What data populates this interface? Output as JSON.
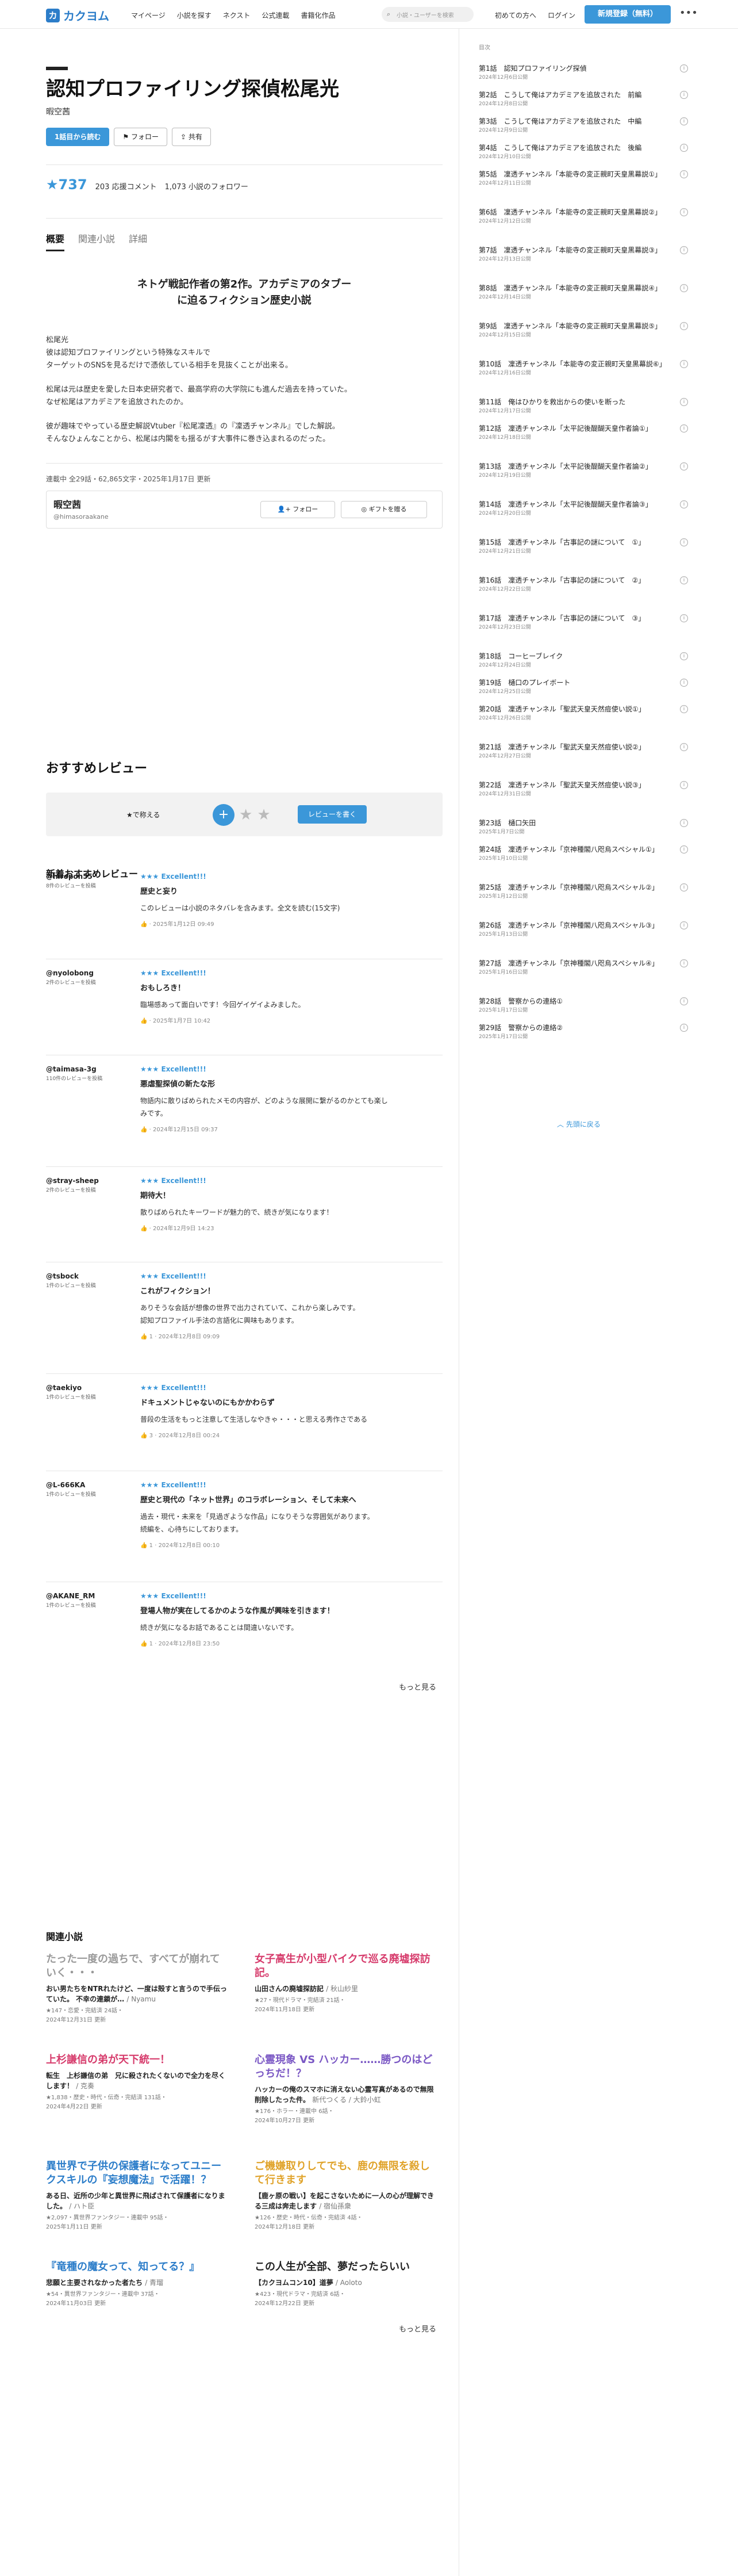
{
  "header": {
    "logo_mark": "カ",
    "logo_text": "カクヨム",
    "nav": [
      "マイページ",
      "小説を探す",
      "ネクスト",
      "公式連載",
      "書籍化作品"
    ],
    "search_placeholder": "小説・ユーザーを検索",
    "beginner": "初めての方へ",
    "login": "ログイン",
    "signup": "新規登録（無料）"
  },
  "work": {
    "title": "認知プロファイリング探偵松尾光",
    "author": "暇空茜",
    "btn_read": "1話目から読む",
    "btn_follow": "フォロー",
    "btn_share": "共有",
    "stars": "★737",
    "review_comments": "203 応援コメント",
    "followers": "1,073 小説のフォロワー"
  },
  "tabs": [
    "概要",
    "関連小説",
    "詳細"
  ],
  "catch": [
    "ネトゲ戦記作者の第2作。アカデミアのタブー",
    "に迫るフィクション歴史小説"
  ],
  "intro": [
    [
      "松尾光",
      "彼は認知プロファイリングという特殊なスキルで",
      "ターゲットのSNSを見るだけで憑依している相手を見抜くことが出来る。"
    ],
    [
      "松尾は元は歴史を愛した日本史研究者で、最高学府の大学院にも進んだ過去を持っていた。",
      "なぜ松尾はアカデミアを追放されたのか。"
    ],
    [
      "彼が趣味でやっている歴史解説Vtuber『松尾凜透』の『凜透チャンネル』でした解説。",
      "そんなひょんなことから、松尾は内閣をも揺るがす大事件に巻き込まれるのだった。"
    ]
  ],
  "meta": "連載中 全29話・62,865文字・2025年1月17日 更新",
  "author_box": {
    "name": "暇空茜",
    "id": "@himasoraakane",
    "follow": "フォロー",
    "gift": "ギフトを贈る"
  },
  "reviews_section": {
    "title": "おすすめレビュー",
    "rate_label": "★で称える",
    "write": "レビューを書く",
    "new_title": "新着おすすめレビュー",
    "items": [
      {
        "user": "@hiropon55",
        "count": "8件のレビューを投稿",
        "score": "★★★ Excellent!!!",
        "title": "歴史と妄り",
        "text": [
          "このレビューは小説のネタバレを含みます。全文を読む(15文字)"
        ],
        "likes": "",
        "date": "2025年1月12日 09:49"
      },
      {
        "user": "@nyolobong",
        "count": "2件のレビューを投稿",
        "score": "★★★ Excellent!!!",
        "title": "おもしろき！",
        "text": [
          "臨場感あって面白いです！今回ゲイゲイよみました。"
        ],
        "likes": "",
        "date": "2025年1月7日 10:42"
      },
      {
        "user": "@taimasa-3g",
        "count": "110件のレビューを投稿",
        "score": "★★★ Excellent!!!",
        "title": "悪虐聖探偵の新たな形",
        "text": [
          "物語内に散りばめられたメモの内容が、どのような展開に繋がるのかとても楽し",
          "みです。"
        ],
        "likes": "",
        "date": "2024年12月15日 09:37"
      },
      {
        "user": "@stray-sheep",
        "count": "2件のレビューを投稿",
        "score": "★★★ Excellent!!!",
        "title": "期待大！",
        "text": [
          "散りばめられたキーワードが魅力的で、続きが気になります！"
        ],
        "likes": "",
        "date": "2024年12月9日 14:23"
      },
      {
        "user": "@tsbock",
        "count": "1件のレビューを投稿",
        "score": "★★★ Excellent!!!",
        "title": "これがフィクション！",
        "text": [
          "ありそうな会話が想像の世界で出力されていて、これから楽しみです。",
          "認知プロファイル手法の言語化に興味もあります。"
        ],
        "likes": "1",
        "date": "2024年12月8日 09:09"
      },
      {
        "user": "@taekiyo",
        "count": "1件のレビューを投稿",
        "score": "★★★ Excellent!!!",
        "title": "ドキュメントじゃないのにもかかわらず",
        "text": [
          "普段の生活をもっと注意して生活しなやきゃ・・・と思える秀作さである"
        ],
        "likes": "3",
        "date": "2024年12月8日 00:24"
      },
      {
        "user": "@L-666KA",
        "count": "1件のレビューを投稿",
        "score": "★★★ Excellent!!!",
        "title": "歴史と現代の「ネット世界」のコラボレーション、そして未来へ",
        "text": [
          "過去・現代・未来を「見過ぎような作品」になりそうな雰囲気があります。",
          "続編を、心待ちにしております。"
        ],
        "likes": "1",
        "date": "2024年12月8日 00:10"
      },
      {
        "user": "@AKANE_RM",
        "count": "1件のレビューを投稿",
        "score": "★★★ Excellent!!!",
        "title": "登場人物が実在してるかのような作風が興味を引きます！",
        "text": [
          "続きが気になるお話であることは間違いないです。"
        ],
        "likes": "1",
        "date": "2024年12月8日 23:50"
      }
    ],
    "see_more": "もっと見る"
  },
  "related": {
    "title": "関連小説",
    "items": [
      {
        "title": "たった一度の過ちで、すべてが崩れていく・・・",
        "sub": "おい男たちをNTRれたけど、一度は殻すと言うので手伝っていた。 不幸の連鎖が…",
        "author": "/ Nyamu",
        "meta": [
          "★147・恋愛・完結済 24話・",
          "2024年12月31日 更新"
        ],
        "color": "#999999"
      },
      {
        "title": "女子高生が小型バイクで巡る廃墟探訪記。",
        "sub": "山田さんの廃墟探訪記",
        "author": "/ 秋山紗里",
        "meta": [
          "★27・現代ドラマ・完結済 21話・",
          "2024年11月18日 更新"
        ],
        "color": "#d63a6b"
      },
      {
        "title": "上杉謙信の弟が天下統一！",
        "sub": "転生　上杉謙信の弟　兄に殺されたくないので全力を尽くします！",
        "author": "/ 克奏",
        "meta": [
          "★1,838・歴史・時代・伝奇・完結済 131話・",
          "2024年4月22日 更新"
        ],
        "color": "#d63a6b"
      },
      {
        "title": "心霊現象 VS ハッカー……勝つのはどっちだ！？",
        "sub": "ハッカーの俺のスマホに消えない心霊写真があるので無限削除したった件。",
        "author": "新代つくる / 大鈴小虹",
        "meta": [
          "★176・ホラー・連載中 6話・",
          "2024年10月27日 更新"
        ],
        "color": "#7a57c4"
      },
      {
        "title": "異世界で子供の保護者になってユニークスキルの『妄想魔法』で活躍！？",
        "sub": "ある日、近所の少年と異世界に飛ばされて保護者になりました。",
        "author": "/ ハト臣",
        "meta": [
          "★2,097・異世界ファンタジー・連載中 95話・",
          "2025年1月11日 更新"
        ],
        "color": "#2c7dc9"
      },
      {
        "title": "ご機嫌取りしてでも、鹿の無限を殺して行きます",
        "sub": "【鹿ヶ原の戦い】を起こさないために一人の心が理解できる三成は奔走します",
        "author": "/ 宿仙孫衆",
        "meta": [
          "★126・歴史・時代・伝奇・完結済 4話・",
          "2024年12月18日 更新"
        ],
        "color": "#e0a32a"
      },
      {
        "title": "『竜種の魔女って、知ってる？』",
        "sub": "悲願と主要されなかった者たち",
        "author": "/ 青瑠",
        "meta": [
          "★54・異世界ファンタジー・連載中 37話・",
          "2024年11月03日 更新"
        ],
        "color": "#2c7dc9"
      },
      {
        "title": "この人生が全部、夢だったらいい",
        "sub": "【カクヨムコン10】道夢",
        "author": "/ Aoloto",
        "meta": [
          "★423・現代ドラマ・完結済 6話・",
          "2024年12月22日 更新"
        ],
        "color": "#222222"
      }
    ],
    "see_more": "もっと見る"
  },
  "toc": {
    "label": "目次",
    "back": "先頭に戻る",
    "items": [
      {
        "title": "第1話　認知プロファイリング探偵",
        "date": "2024年12月6日公開"
      },
      {
        "title": "第2話　こうして俺はアカデミアを追放された　前編",
        "date": "2024年12月8日公開"
      },
      {
        "title": "第3話　こうして俺はアカデミアを追放された　中編",
        "date": "2024年12月9日公開"
      },
      {
        "title": "第4話　こうして俺はアカデミアを追放された　後編",
        "date": "2024年12月10日公開"
      },
      {
        "title": "第5話　凜透チャンネル「本能寺の変正親町天皇黒幕説①」",
        "date": "2024年12月11日公開"
      },
      {
        "title": "第6話　凜透チャンネル「本能寺の変正親町天皇黒幕説②」",
        "date": "2024年12月12日公開"
      },
      {
        "title": "第7話　凜透チャンネル「本能寺の変正親町天皇黒幕説③」",
        "date": "2024年12月13日公開"
      },
      {
        "title": "第8話　凜透チャンネル「本能寺の変正親町天皇黒幕説④」",
        "date": "2024年12月14日公開"
      },
      {
        "title": "第9話　凜透チャンネル「本能寺の変正親町天皇黒幕説⑤」",
        "date": "2024年12月15日公開"
      },
      {
        "title": "第10話　凜透チャンネル「本能寺の変正親町天皇黒幕説⑥」",
        "date": "2024年12月16日公開"
      },
      {
        "title": "第11話　俺はひかりを救出からの使いを断った",
        "date": "2024年12月17日公開"
      },
      {
        "title": "第12話　凜透チャンネル「太平記後醍醐天皇作者論①」",
        "date": "2024年12月18日公開"
      },
      {
        "title": "第13話　凜透チャンネル「太平記後醍醐天皇作者論②」",
        "date": "2024年12月19日公開"
      },
      {
        "title": "第14話　凜透チャンネル「太平記後醍醐天皇作者論③」",
        "date": "2024年12月20日公開"
      },
      {
        "title": "第15話　凜透チャンネル「古事記の謎について　①」",
        "date": "2024年12月21日公開"
      },
      {
        "title": "第16話　凜透チャンネル「古事記の謎について　②」",
        "date": "2024年12月22日公開"
      },
      {
        "title": "第17話　凜透チャンネル「古事記の謎について　③」",
        "date": "2024年12月23日公開"
      },
      {
        "title": "第18話　コーヒーブレイク",
        "date": "2024年12月24日公開"
      },
      {
        "title": "第19話　樋口のプレイボート",
        "date": "2024年12月25日公開"
      },
      {
        "title": "第20話　凜透チャンネル「聖武天皇天然痘使い説①」",
        "date": "2024年12月26日公開"
      },
      {
        "title": "第21話　凜透チャンネル「聖武天皇天然痘使い説②」",
        "date": "2024年12月27日公開"
      },
      {
        "title": "第22話　凜透チャンネル「聖武天皇天然痘使い説③」",
        "date": "2024年12月31日公開"
      },
      {
        "title": "第23話　樋口矢田",
        "date": "2025年1月7日公開"
      },
      {
        "title": "第24話　凜透チャンネル「京神種閣八咫烏スペシャル①」",
        "date": "2025年1月10日公開"
      },
      {
        "title": "第25話　凜透チャンネル「京神種閣八咫烏スペシャル②」",
        "date": "2025年1月12日公開"
      },
      {
        "title": "第26話　凜透チャンネル「京神種閣八咫烏スペシャル③」",
        "date": "2025年1月13日公開"
      },
      {
        "title": "第27話　凜透チャンネル「京神種閣八咫烏スペシャル④」",
        "date": "2025年1月16日公開"
      },
      {
        "title": "第28話　警察からの連絡①",
        "date": "2025年1月17日公開"
      },
      {
        "title": "第29話　警察からの連絡②",
        "date": "2025年1月17日公開"
      }
    ]
  }
}
